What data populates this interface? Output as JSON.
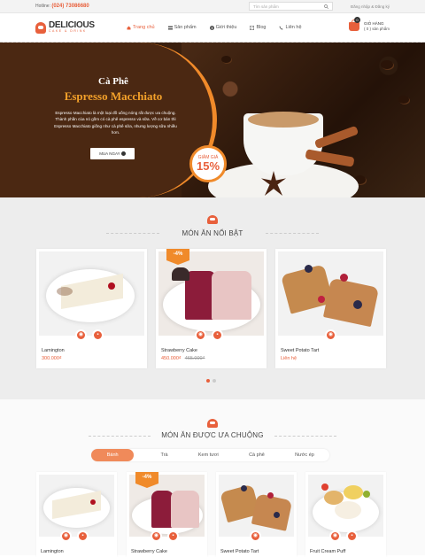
{
  "topbar": {
    "hotline_label": "Hotline:",
    "hotline_number": "(024) 73086680",
    "search_placeholder": "Tìm sản phẩm",
    "auth_text": "Đăng nhập & Đăng ký"
  },
  "header": {
    "logo_name": "DELICIOUS",
    "logo_tagline": "CAKE & DRINK",
    "nav": [
      "Trang chủ",
      "Sản phẩm",
      "Giới thiệu",
      "Blog",
      "Liên hệ"
    ],
    "cart_count": "0",
    "cart_title": "GIỎ HÀNG",
    "cart_sub": "( 0 ) sản phẩm"
  },
  "hero": {
    "title1": "Cà Phê",
    "title2": "Espresso Macchiato",
    "desc": "Espresso Macchiato là một loại đồ uống nóng rất được ưa chuộng. Thành phần của nó gồm có cà phê espresso và sữa. Về cơ bản thì Espresso Macchiato giống như cà phê sữa, nhưng lượng sữa nhiều hơn.",
    "button": "MUA NGAY",
    "discount_label": "GIẢM GIÁ",
    "discount_value": "15%"
  },
  "featured": {
    "title": "MÓN ĂN NỔI BẬT",
    "products": [
      {
        "name": "Lamington",
        "price": "300.000₫",
        "old_price": ""
      },
      {
        "name": "Strawberry Cake",
        "price": "450.000₫",
        "old_price": "465.000₫",
        "ribbon": "-4%"
      },
      {
        "name": "Sweet Potato Tart",
        "price": "Liên hệ",
        "old_price": ""
      }
    ]
  },
  "popular": {
    "title": "MÓN ĂN ĐƯỢC ƯA CHUỘNG",
    "tabs": [
      "Bánh",
      "Trà",
      "Kem tươi",
      "Cà phê",
      "Nước ép"
    ],
    "products": [
      {
        "name": "Lamington"
      },
      {
        "name": "Strawberry Cake",
        "ribbon": "-4%"
      },
      {
        "name": "Sweet Potato Tart"
      },
      {
        "name": "Fruit Cream Puff"
      }
    ]
  },
  "colors": {
    "accent": "#e8603c",
    "orange": "#f08a2a",
    "brown": "#4b2812"
  }
}
